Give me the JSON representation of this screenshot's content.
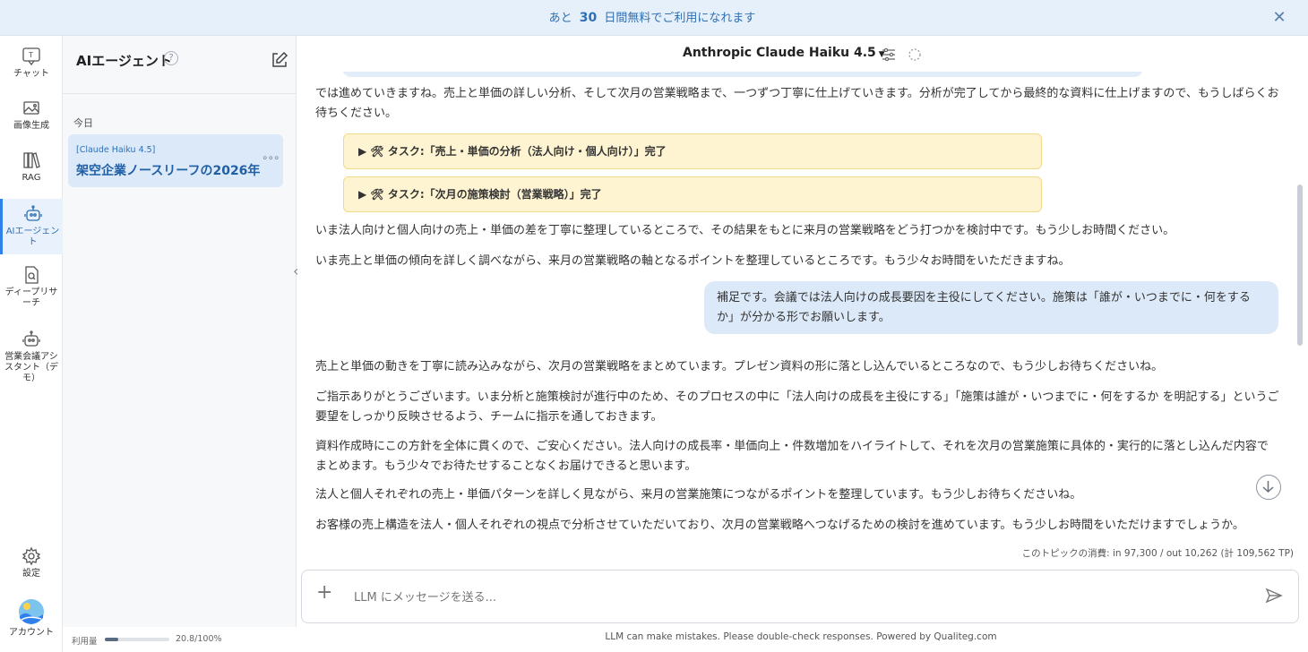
{
  "banner": {
    "prefix": "あと",
    "days": "30",
    "suffix": "日間無料でご利用になれます",
    "close_icon": "close-icon"
  },
  "nav": {
    "items": [
      {
        "label": "チャット",
        "icon": "chat-icon"
      },
      {
        "label": "画像生成",
        "icon": "image-icon"
      },
      {
        "label": "RAG",
        "icon": "books-icon"
      },
      {
        "label": "AIエージェント",
        "icon": "robot-icon",
        "active": true
      },
      {
        "label": "ディープリサーチ",
        "icon": "search-doc-icon"
      },
      {
        "label": "営業会議アシスタント（デモ）",
        "icon": "robot-icon"
      }
    ],
    "settings_label": "設定",
    "account_label": "アカウント"
  },
  "sidebar": {
    "title": "AIエージェント",
    "help": "?",
    "date_group": "今日",
    "conversation": {
      "model": "[Claude Haiku 4.5]",
      "title": "架空企業ノースリーフの2026年"
    },
    "usage_label": "利用量",
    "usage_value": "20.8/100%",
    "usage_percent": 20.8
  },
  "header": {
    "model": "Anthropic Claude Haiku 4.5"
  },
  "messages": {
    "m1": "では進めていきますね。売上と単価の詳しい分析、そして次月の営業戦略まで、一つずつ丁寧に仕上げていきます。分析が完了してから最終的な資料に仕上げますので、もうしばらくお待ちください。",
    "task1": "▶ 🛠 タスク:「売上・単価の分析（法人向け・個人向け）」完了",
    "task2": "▶ 🛠 タスク:「次月の施策検討（営業戦略）」完了",
    "m2": "いま法人向けと個人向けの売上・単価の差を丁寧に整理しているところで、その結果をもとに来月の営業戦略をどう打つかを検討中です。もう少しお時間ください。",
    "m3": "いま売上と単価の傾向を詳しく調べながら、来月の営業戦略の軸となるポイントを整理しているところです。もう少々お時間をいただきますね。",
    "user": "補足です。会議では法人向けの成長要因を主役にしてください。施策は「誰が・いつまでに・何をするか」が分かる形でお願いします。",
    "m4": "売上と単価の動きを丁寧に読み込みながら、次月の営業戦略をまとめています。プレゼン資料の形に落とし込んでいるところなので、もう少しお待ちくださいね。",
    "m5": "ご指示ありがとうございます。いま分析と施策検討が進行中のため、そのプロセスの中に「法人向けの成長を主役にする」「施策は誰が・いつまでに・何をするか を明記する」というご要望をしっかり反映させるよう、チームに指示を通しておきます。",
    "m6": "資料作成時にこの方針を全体に貫くので、ご安心ください。法人向けの成長率・単価向上・件数増加をハイライトして、それを次月の営業施策に具体的・実行的に落とし込んだ内容でまとめます。もう少々でお待たせすることなくお届けできると思います。",
    "m7": "法人と個人それぞれの売上・単価パターンを詳しく見ながら、来月の営業施策につながるポイントを整理しています。もう少しお待ちくださいね。",
    "m8": "お客様の売上構造を法人・個人それぞれの視点で分析させていただいており、次月の営業戦略へつなげるための検討を進めています。もう少しお時間をいただけますでしょうか。"
  },
  "tokens": "このトピックの消費: in 97,300 / out 10,262 (計 109,562 TP)",
  "input": {
    "placeholder": "LLM にメッセージを送る..."
  },
  "footer": "LLM can make mistakes. Please double-check responses. Powered by Qualiteg.com"
}
